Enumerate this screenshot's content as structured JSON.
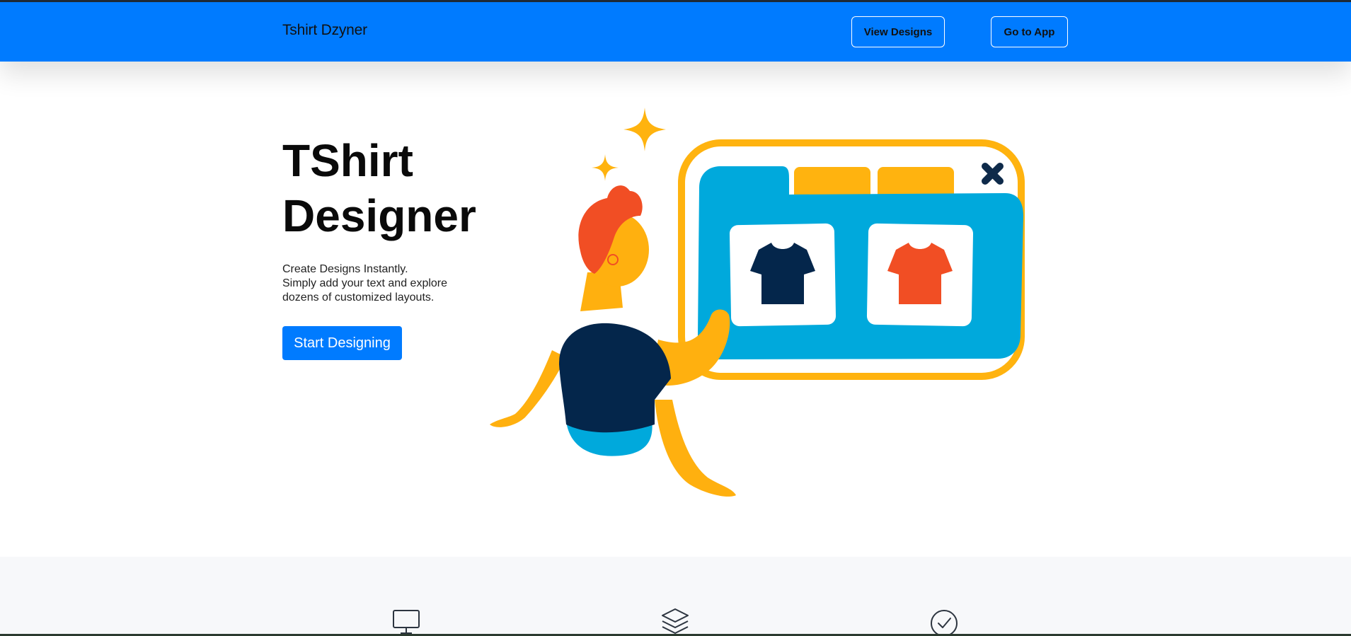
{
  "navbar": {
    "brand": "Tshirt Dzyner",
    "view_designs_label": "View Designs",
    "go_to_app_label": "Go to App",
    "background_color": "#007bff"
  },
  "hero": {
    "title_line1": "TShirt",
    "title_line2": "Designer",
    "text_line1": "Create Designs Instantly.",
    "text_line2": "Simply add your text and explore",
    "text_line3": "dozens of customized layouts.",
    "cta_label": "Start Designing",
    "accent_color": "#007bff"
  },
  "illustration": {
    "icons": [
      "person-illustration",
      "browser-window",
      "navy-tshirt-icon",
      "orange-tshirt-icon",
      "sparkle-icon",
      "close-x-icon"
    ],
    "colors": {
      "window_frame": "#ffb30f",
      "window_body": "#00a9dc",
      "navy_shirt": "#04264b",
      "orange_shirt": "#f14e24",
      "skin": "#ffb00f",
      "hair": "#f14e24"
    }
  },
  "features": {
    "icons": [
      "monitor-icon",
      "layers-icon",
      "check-circle-icon"
    ],
    "background_color": "#f7f8fa"
  }
}
